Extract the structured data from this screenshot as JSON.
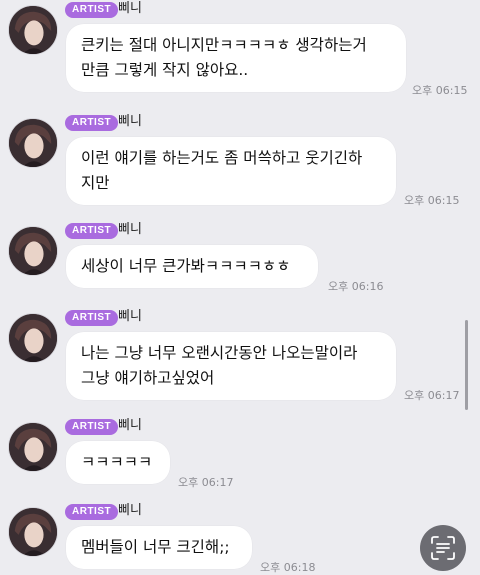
{
  "badge_label": "ARTIST",
  "messages": [
    {
      "sender": "삐니",
      "lines": [
        "큰키는 절대 아니지만ㅋㅋㅋㅋㅎ 생각하는거",
        "만큼 그렇게 작지 않아요.."
      ],
      "time": "오후 06:15"
    },
    {
      "sender": "삐니",
      "lines": [
        "이런 얘기를 하는거도 좀 머쓱하고 웃기긴하",
        "지만"
      ],
      "time": "오후 06:15"
    },
    {
      "sender": "삐니",
      "lines": [
        "세상이 너무 큰가봐ㅋㅋㅋㅋㅎㅎ"
      ],
      "time": "오후 06:16"
    },
    {
      "sender": "삐니",
      "lines": [
        "나는 그냥 너무 오랜시간동안 나오는말이라",
        "그냥 얘기하고싶었어"
      ],
      "time": "오후 06:17"
    },
    {
      "sender": "삐니",
      "lines": [
        "ㅋㅋㅋㅋㅋ"
      ],
      "time": "오후 06:17"
    },
    {
      "sender": "삐니",
      "lines": [
        "멤버들이 너무 크긴해;;"
      ],
      "time": "오후 06:18"
    }
  ],
  "colors": {
    "background": "#ececf0",
    "badge": "#a96bdf",
    "bubble": "#ffffff",
    "timestamp": "#8c8c92",
    "scan_button": "#6c6c72"
  },
  "icons": {
    "scan_button": "text-scan-icon"
  }
}
